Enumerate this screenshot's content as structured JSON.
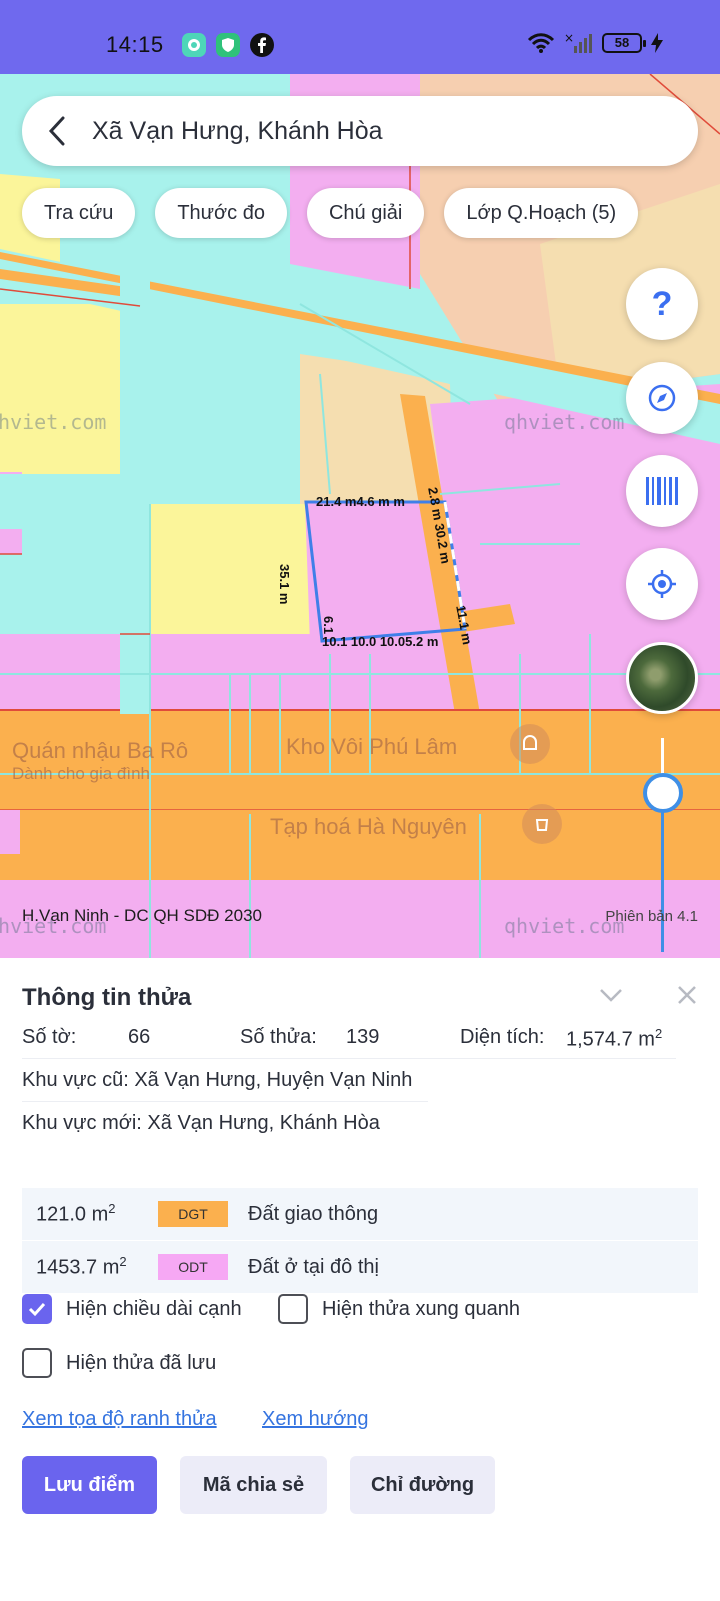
{
  "status_bar": {
    "time": "14:15",
    "battery": "58",
    "icons": [
      "chat-app-icon",
      "shield-app-icon",
      "facebook-icon",
      "wifi-icon",
      "signal-icon",
      "charging-icon"
    ]
  },
  "search": {
    "back_icon": "chevron-left-icon",
    "query": "Xã Vạn Hưng, Khánh Hòa"
  },
  "chips": [
    "Tra cứu",
    "Thước đo",
    "Chú giải",
    "Lớp Q.Hoạch (5)"
  ],
  "map_controls": [
    "help-icon",
    "compass-icon",
    "barcode-icon",
    "locate-icon",
    "satellite-layer-icon"
  ],
  "map": {
    "caption": "H.Vạn Ninh - DC QH SDĐ 2030",
    "version": "Phiên bản 4.1",
    "watermark": "qhviet.com",
    "pois": [
      "Quán nhậu Ba Rô",
      "Dành cho gia đình",
      "Kho Vôi Phú Lâm",
      "Tạp hoá Hà Nguyên"
    ],
    "dimensions": {
      "top": "21.4 m4.6 m m",
      "left": "35.1 m",
      "right_upper": "2.8 m  30.2 m",
      "right_lower": "11.1 m",
      "bottom": "10.1 10.0 10.05.2 m",
      "bottom_left": "6.1"
    },
    "colors": {
      "cyan": "#a8f2ec",
      "pink": "#f3aef0",
      "yellow": "#fbf59a",
      "orange": "#fbb04e",
      "beige": "#f5deb0",
      "salmon": "#f6cfb0",
      "parcel_border": "#3f7fe8"
    }
  },
  "sheet": {
    "title": "Thông tin thửa",
    "so_to_label": "Số tờ:",
    "so_to_value": "66",
    "so_thua_label": "Số thửa:",
    "so_thua_value": "139",
    "dien_tich_label": "Diện tích:",
    "dien_tich_value": "1,574.7 m",
    "dien_tich_sup": "2",
    "khu_vuc_cu": "Khu vực cũ:  Xã Vạn Hưng, Huyện Vạn Ninh",
    "khu_vuc_moi": "Khu vực mới:  Xã Vạn Hưng, Khánh Hòa",
    "land_uses": [
      {
        "area": "121.0 m",
        "sup": "2",
        "code": "DGT",
        "name": "Đất giao thông",
        "color": "#fbb04e"
      },
      {
        "area": "1453.7 m",
        "sup": "2",
        "code": "ODT",
        "name": "Đất ở tại đô thị",
        "color": "#f6a8f4"
      }
    ],
    "checkboxes": [
      {
        "label": "Hiện chiều dài cạnh",
        "checked": true
      },
      {
        "label": "Hiện thửa xung quanh",
        "checked": false
      },
      {
        "label": "Hiện thửa đã lưu",
        "checked": false
      }
    ],
    "links": [
      "Xem tọa độ ranh thửa",
      "Xem hướng"
    ],
    "buttons": [
      "Lưu điểm",
      "Mã chia sẻ",
      "Chỉ đường"
    ]
  }
}
